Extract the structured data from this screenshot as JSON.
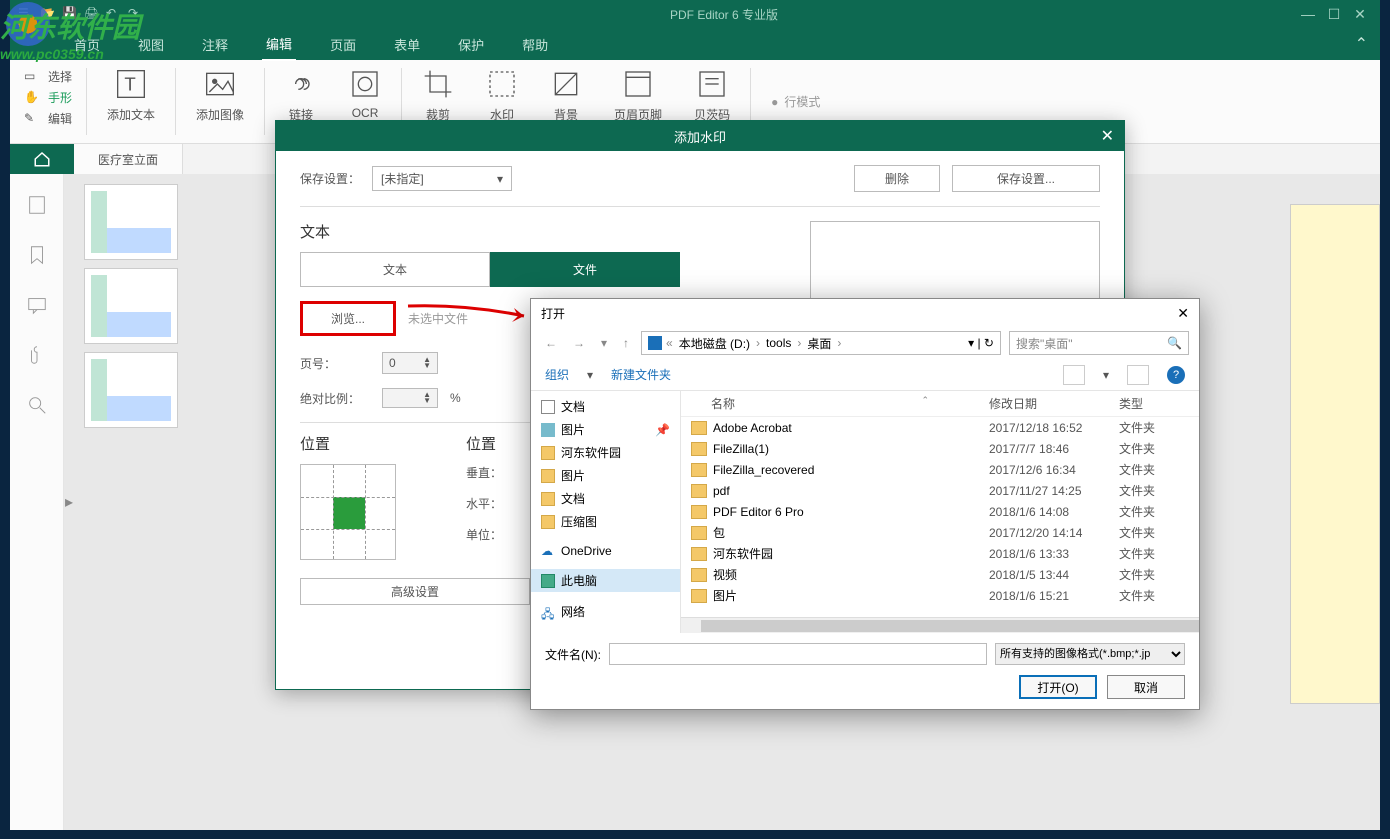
{
  "app": {
    "title": "PDF Editor 6 专业版"
  },
  "menu": {
    "home": "首页",
    "view": "视图",
    "annotate": "注释",
    "edit": "编辑",
    "page": "页面",
    "form": "表单",
    "protect": "保护",
    "help": "帮助"
  },
  "tools": {
    "select": "选择",
    "hand": "手形",
    "edit": "编辑",
    "add_text": "添加文本",
    "add_image": "添加图像",
    "link": "链接",
    "ocr": "OCR",
    "crop": "裁剪",
    "watermark": "水印",
    "background": "背景",
    "header": "页眉页脚",
    "bates": "贝茨码",
    "mode": "行模式"
  },
  "document": {
    "tab_name": "医疗室立面"
  },
  "wm_dialog": {
    "title": "添加水印",
    "save_settings_label": "保存设置：",
    "save_settings_value": "[未指定]",
    "delete_btn": "删除",
    "save_btn": "保存设置...",
    "text_section": "文本",
    "tab_text": "文本",
    "tab_file": "文件",
    "browse": "浏览...",
    "no_file": "未选中文件",
    "page_label": "页号：",
    "page_value": "0",
    "scale_label": "绝对比例：",
    "scale_unit": "%",
    "position_label": "位置",
    "position2_label": "位置",
    "vertical_label": "垂直：",
    "horizontal_label": "水平：",
    "unit_label": "单位：",
    "advanced": "高级设置"
  },
  "file_dialog": {
    "title": "打开",
    "path": {
      "drive": "本地磁盘 (D:)",
      "p1": "tools",
      "p2": "桌面"
    },
    "search_placeholder": "搜索\"桌面\"",
    "organize": "组织",
    "new_folder": "新建文件夹",
    "columns": {
      "name": "名称",
      "date": "修改日期",
      "type": "类型"
    },
    "tree": [
      {
        "label": "文档",
        "icon": "doc"
      },
      {
        "label": "图片",
        "icon": "pic",
        "pinned": true
      },
      {
        "label": "河东软件园",
        "icon": "folder"
      },
      {
        "label": "图片",
        "icon": "folder"
      },
      {
        "label": "文档",
        "icon": "folder"
      },
      {
        "label": "压缩图",
        "icon": "folder"
      },
      {
        "label": "",
        "icon": "spacer"
      },
      {
        "label": "OneDrive",
        "icon": "onedrive"
      },
      {
        "label": "",
        "icon": "spacer"
      },
      {
        "label": "此电脑",
        "icon": "pc",
        "selected": true
      },
      {
        "label": "",
        "icon": "spacer"
      },
      {
        "label": "网络",
        "icon": "network"
      }
    ],
    "files": [
      {
        "name": "Adobe Acrobat",
        "date": "2017/12/18 16:52",
        "type": "文件夹"
      },
      {
        "name": "FileZilla(1)",
        "date": "2017/7/7 18:46",
        "type": "文件夹"
      },
      {
        "name": "FileZilla_recovered",
        "date": "2017/12/6 16:34",
        "type": "文件夹"
      },
      {
        "name": "pdf",
        "date": "2017/11/27 14:25",
        "type": "文件夹"
      },
      {
        "name": "PDF Editor 6 Pro",
        "date": "2018/1/6 14:08",
        "type": "文件夹"
      },
      {
        "name": "包",
        "date": "2017/12/20 14:14",
        "type": "文件夹"
      },
      {
        "name": "河东软件园",
        "date": "2018/1/6 13:33",
        "type": "文件夹"
      },
      {
        "name": "视频",
        "date": "2018/1/5 13:44",
        "type": "文件夹"
      },
      {
        "name": "图片",
        "date": "2018/1/6 15:21",
        "type": "文件夹"
      }
    ],
    "filename_label": "文件名(N):",
    "filter": "所有支持的图像格式(*.bmp;*.jp",
    "open_btn": "打开(O)",
    "cancel_btn": "取消"
  },
  "watermark_brand": {
    "main": "河东软件园",
    "sub": "www.pc0359.cn"
  }
}
